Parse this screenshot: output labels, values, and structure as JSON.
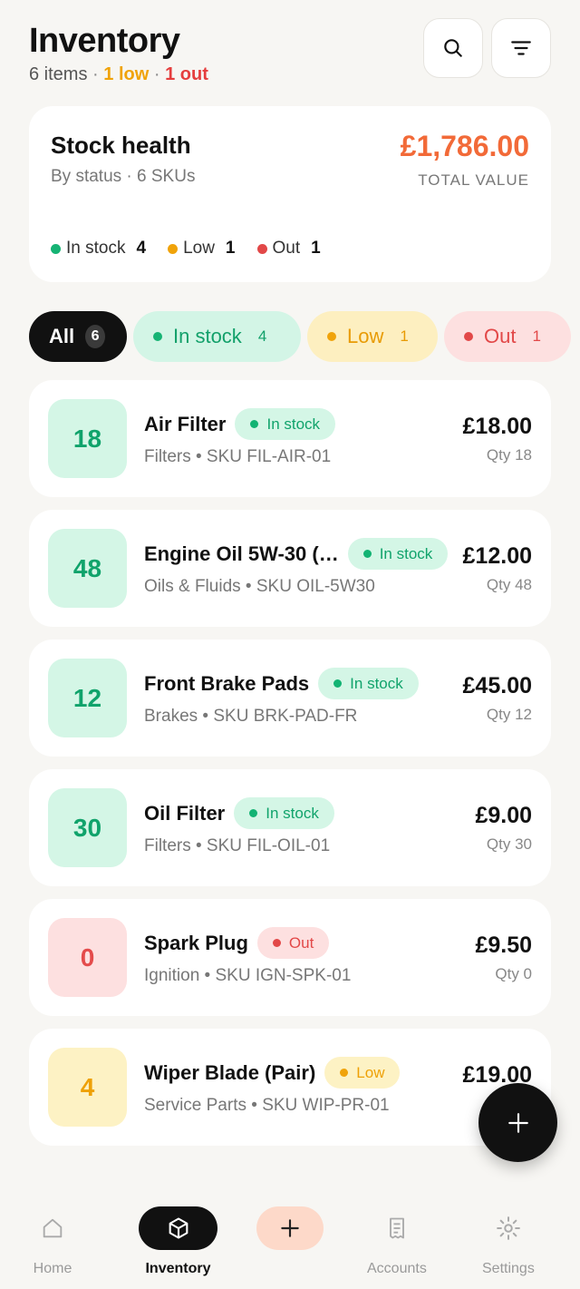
{
  "header": {
    "title": "Inventory",
    "item_count": "6 items",
    "sep1": "·",
    "low_text": "1 low",
    "sep2": "·",
    "out_text": "1 out"
  },
  "stock_health": {
    "title": "Stock health",
    "subtitle": "By status · 6 SKUs",
    "total_value": "£1,786.00",
    "total_label": "TOTAL VALUE",
    "legend": [
      {
        "label": "In stock",
        "count": "4",
        "color": "#16b374"
      },
      {
        "label": "Low",
        "count": "1",
        "color": "#f0a30a"
      },
      {
        "label": "Out",
        "count": "1",
        "color": "#e24848"
      }
    ]
  },
  "filters": [
    {
      "label": "All",
      "count": "6"
    },
    {
      "label": "In stock",
      "count": "4"
    },
    {
      "label": "Low",
      "count": "1"
    },
    {
      "label": "Out",
      "count": "1"
    }
  ],
  "items": [
    {
      "qty_box": "18",
      "name": "Air Filter",
      "status": "In stock",
      "meta": "Filters • SKU FIL-AIR-01",
      "price": "£18.00",
      "qty": "Qty 18"
    },
    {
      "qty_box": "48",
      "name": "Engine Oil 5W-30 (…",
      "status": "In stock",
      "meta": "Oils & Fluids • SKU OIL-5W30",
      "price": "£12.00",
      "qty": "Qty 48"
    },
    {
      "qty_box": "12",
      "name": "Front Brake Pads",
      "status": "In stock",
      "meta": "Brakes • SKU BRK-PAD-FR",
      "price": "£45.00",
      "qty": "Qty 12"
    },
    {
      "qty_box": "30",
      "name": "Oil Filter",
      "status": "In stock",
      "meta": "Filters • SKU FIL-OIL-01",
      "price": "£9.00",
      "qty": "Qty 30"
    },
    {
      "qty_box": "0",
      "name": "Spark Plug",
      "status": "Out",
      "meta": "Ignition • SKU IGN-SPK-01",
      "price": "£9.50",
      "qty": "Qty 0"
    },
    {
      "qty_box": "4",
      "name": "Wiper Blade (Pair)",
      "status": "Low",
      "meta": "Service Parts • SKU WIP-PR-01",
      "price": "£19.00",
      "qty": ""
    }
  ],
  "nav": [
    {
      "label": "Home",
      "icon": "home-icon"
    },
    {
      "label": "Inventory",
      "icon": "box-icon"
    },
    {
      "label": "",
      "icon": "plus-icon"
    },
    {
      "label": "Accounts",
      "icon": "receipt-icon"
    },
    {
      "label": "Settings",
      "icon": "gear-icon"
    }
  ]
}
